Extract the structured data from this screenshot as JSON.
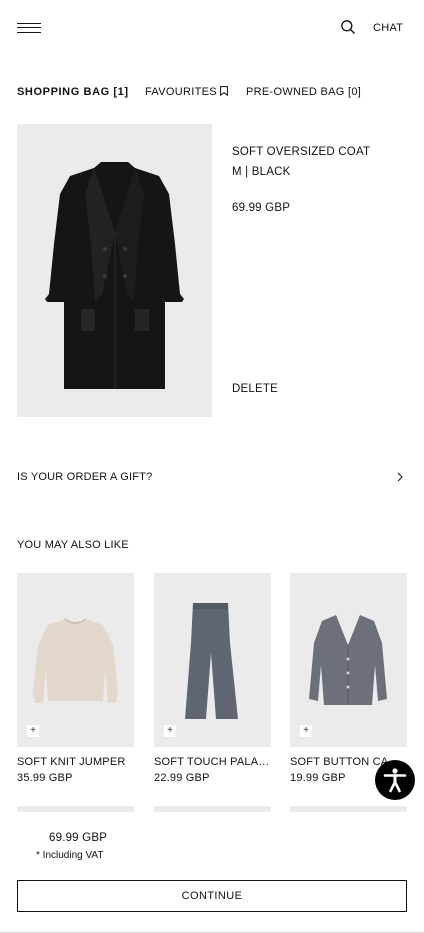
{
  "header": {
    "menu_icon": "hamburger-menu-icon",
    "search_icon": "search-icon",
    "chat_label": "CHAT"
  },
  "tabs": {
    "shopping_bag": "SHOPPING BAG [1]",
    "favourites": "FAVOURITES",
    "favourites_icon": "bookmark-icon",
    "pre_owned": "PRE-OWNED BAG [0]"
  },
  "cart_item": {
    "name": "SOFT OVERSIZED COAT",
    "variant": "M | BLACK",
    "price": "69.99 GBP",
    "delete_label": "DELETE",
    "image_icon": "coat-product-image"
  },
  "gift": {
    "label": "IS YOUR ORDER A GIFT?",
    "icon": "chevron-right-icon"
  },
  "recommendations": {
    "title": "YOU MAY ALSO LIKE",
    "items": [
      {
        "name": "SOFT KNIT JUMPER",
        "price": "35.99 GBP",
        "plus": "+"
      },
      {
        "name": "SOFT TOUCH PALAZZO TROUSERS",
        "price": "22.99 GBP",
        "plus": "+"
      },
      {
        "name": "SOFT BUTTON CARDIGAN",
        "price": "19.99 GBP",
        "plus": "+"
      }
    ]
  },
  "footer": {
    "total": "69.99 GBP",
    "vat_note": "* Including VAT",
    "continue_label": "CONTINUE"
  },
  "accessibility": {
    "icon": "accessibility-icon"
  },
  "colors": {
    "text": "#111111",
    "image_bg": "#ebebeb",
    "accessibility_bg": "#000000"
  }
}
